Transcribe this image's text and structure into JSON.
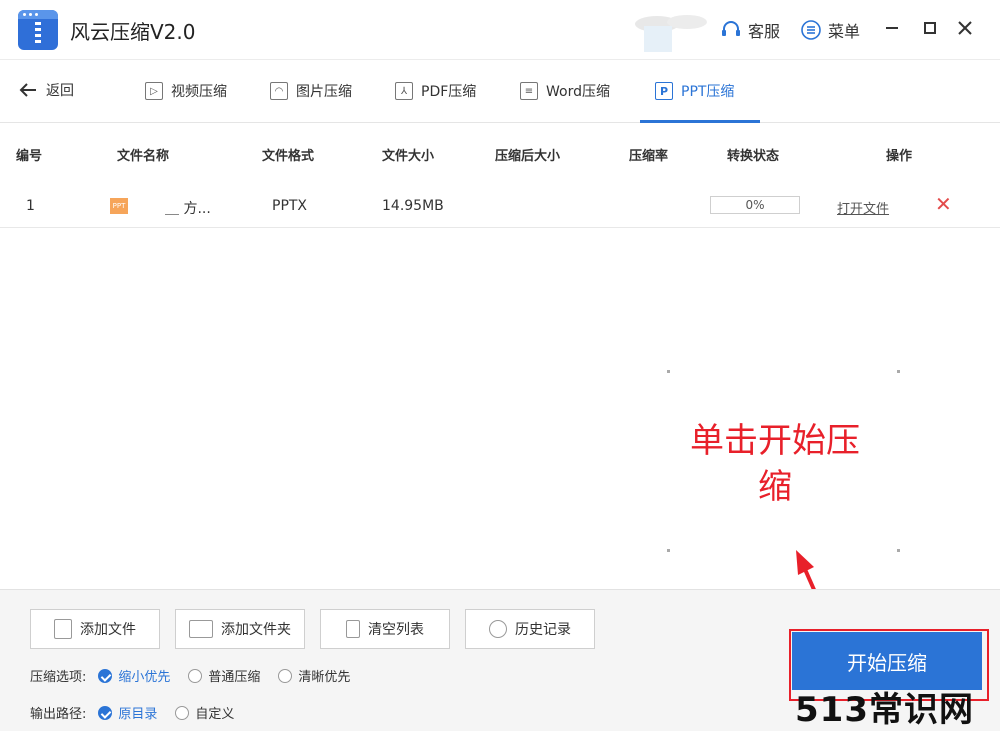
{
  "app": {
    "title": "风云压缩V2.0"
  },
  "titlebar": {
    "service_label": "客服",
    "menu_label": "菜单"
  },
  "nav": {
    "back_label": "返回",
    "tabs": [
      {
        "label": "视频压缩",
        "icon": "video-icon"
      },
      {
        "label": "图片压缩",
        "icon": "image-icon"
      },
      {
        "label": "PDF压缩",
        "icon": "pdf-icon"
      },
      {
        "label": "Word压缩",
        "icon": "word-icon"
      },
      {
        "label": "PPT压缩",
        "icon": "ppt-icon",
        "active": true
      }
    ]
  },
  "table": {
    "headers": [
      "编号",
      "文件名称",
      "文件格式",
      "文件大小",
      "压缩后大小",
      "压缩率",
      "转换状态",
      "操作"
    ],
    "rows": [
      {
        "index": "1",
        "name": "＿ 方...",
        "format": "PPTX",
        "size": "14.95MB",
        "compressed_size": "",
        "ratio": "",
        "status": "0%",
        "open_link": "打开文件",
        "icon_text": "PPT"
      }
    ]
  },
  "annotation": {
    "text": "单击开始压缩"
  },
  "toolbar": {
    "add_file": "添加文件",
    "add_folder": "添加文件夹",
    "clear_list": "清空列表",
    "history": "历史记录"
  },
  "options": {
    "compress_label": "压缩选项:",
    "compress_choices": [
      "缩小优先",
      "普通压缩",
      "清晰优先"
    ],
    "compress_selected": "缩小优先",
    "output_label": "输出路径:",
    "output_choices": [
      "原目录",
      "自定义"
    ],
    "output_selected": "原目录"
  },
  "start_button": {
    "label": "开始压缩"
  },
  "watermark": {
    "text": "513常识网"
  },
  "colors": {
    "accent": "#2b74d6",
    "annotation_red": "#e8202a",
    "delete_red": "#e34b4b"
  }
}
